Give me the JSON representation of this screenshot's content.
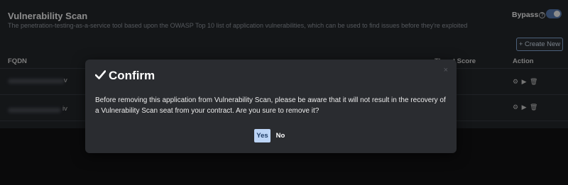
{
  "header": {
    "title": "Vulnerability Scan",
    "description": "The penetration-testing-as-a-service tool based upon the OWASP Top 10 list of application vulnerabilities, which can be used to find issues before they're exploited",
    "bypass_label": "Bypass",
    "bypass_help": "?",
    "bypass_enabled": true
  },
  "toolbar": {
    "create_label": "+ Create New"
  },
  "table": {
    "columns": [
      "FQDN",
      "Threat Score",
      "Action"
    ],
    "rows": [
      {
        "fqdn_visible": "v",
        "actions": "⚙ ▶ 🗑"
      },
      {
        "fqdn_visible": "iv",
        "actions": "⚙ ▶ 🗑"
      }
    ]
  },
  "dialog": {
    "title": "Confirm",
    "title_icon": "check-icon",
    "close_glyph": "×",
    "message": "Before removing this application from Vulnerability Scan, please be aware that it will not result in the recovery of a Vulnerability Scan seat from your contract. Are you sure to remove it?",
    "yes_label": "Yes",
    "no_label": "No"
  },
  "colors": {
    "background": "#131314",
    "panel": "#25282d",
    "modal": "#2a2c30",
    "accent": "#bcd4f5",
    "toggle": "#5a7fb6"
  }
}
